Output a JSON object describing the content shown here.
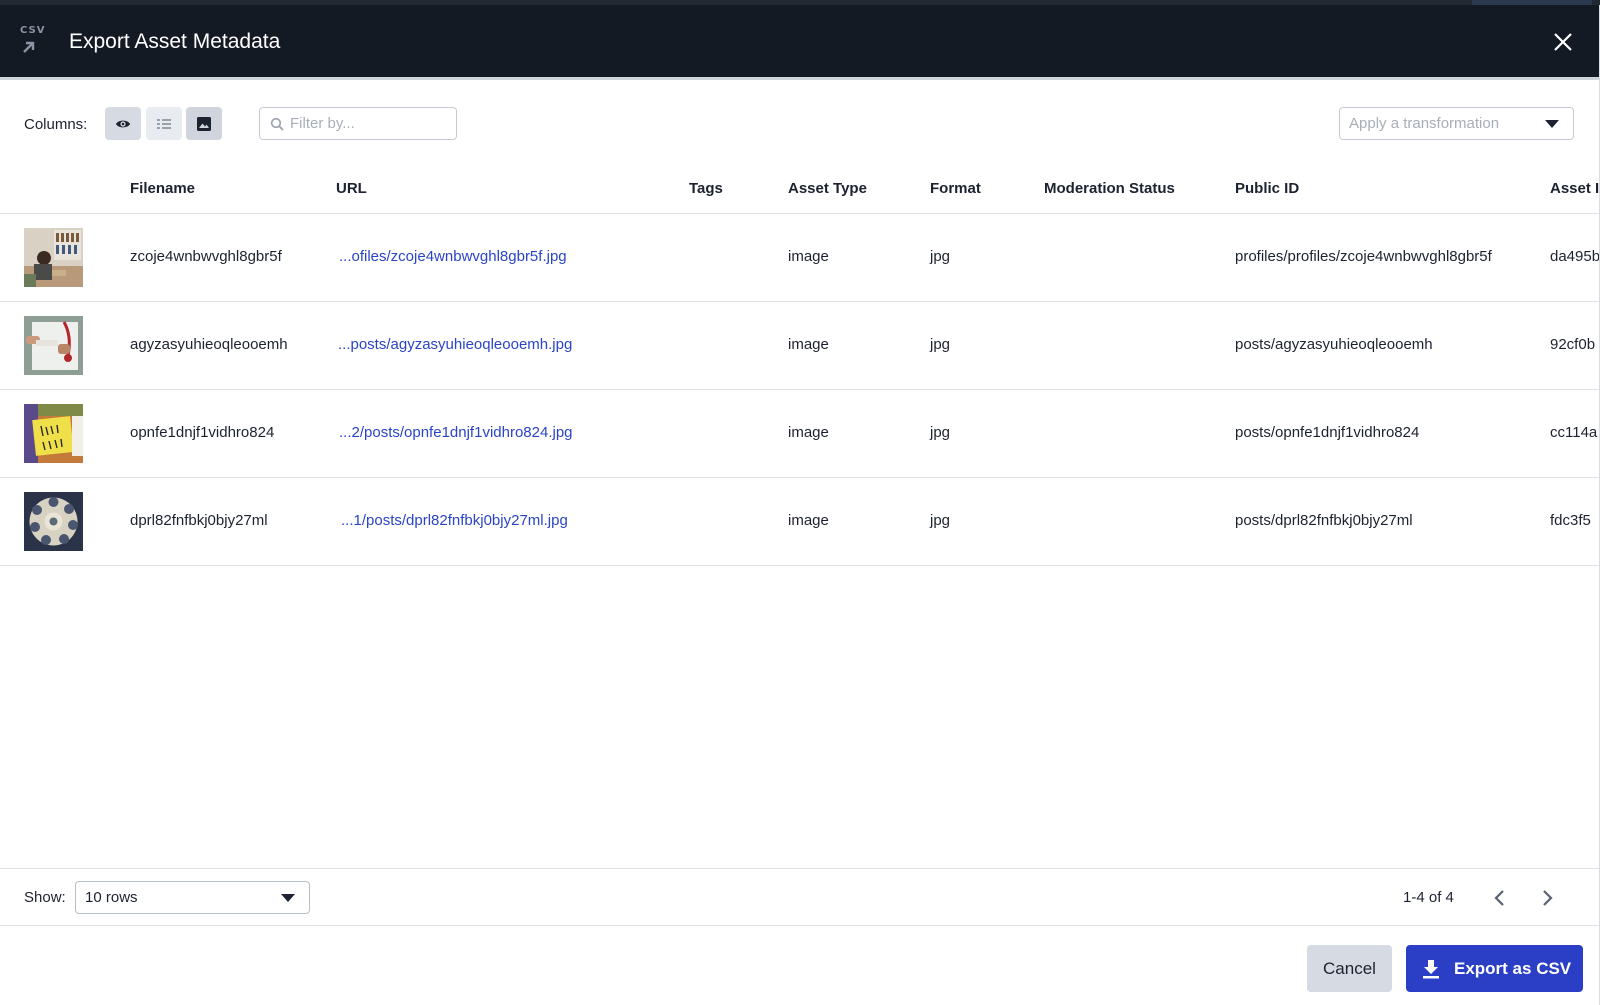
{
  "header": {
    "icon_text": "CSV",
    "title": "Export Asset Metadata"
  },
  "toolbar": {
    "columns_label": "Columns:",
    "filter_placeholder": "Filter by...",
    "transformation_placeholder": "Apply a transformation"
  },
  "table": {
    "columns": [
      "Filename",
      "URL",
      "Tags",
      "Asset Type",
      "Format",
      "Moderation Status",
      "Public ID",
      "Asset I"
    ],
    "rows": [
      {
        "filename": "zcoje4wnbwvghl8gbr5f",
        "url": "...ofiles/zcoje4wnbwvghl8gbr5f.jpg",
        "tags": "",
        "asset_type": "image",
        "format": "jpg",
        "moderation_status": "",
        "public_id": "profiles/profiles/zcoje4wnbwvghl8gbr5f",
        "asset_id": "da495b"
      },
      {
        "filename": "agyzasyuhieoqleooemh",
        "url": "...posts/agyzasyuhieoqleooemh.jpg",
        "tags": "",
        "asset_type": "image",
        "format": "jpg",
        "moderation_status": "",
        "public_id": "posts/agyzasyuhieoqleooemh",
        "asset_id": "92cf0b"
      },
      {
        "filename": "opnfe1dnjf1vidhro824",
        "url": "...2/posts/opnfe1dnjf1vidhro824.jpg",
        "tags": "",
        "asset_type": "image",
        "format": "jpg",
        "moderation_status": "",
        "public_id": "posts/opnfe1dnjf1vidhro824",
        "asset_id": "cc114a"
      },
      {
        "filename": "dprl82fnfbkj0bjy27ml",
        "url": "...1/posts/dprl82fnfbkj0bjy27ml.jpg",
        "tags": "",
        "asset_type": "image",
        "format": "jpg",
        "moderation_status": "",
        "public_id": "posts/dprl82fnfbkj0bjy27ml",
        "asset_id": "fdc3f5"
      }
    ]
  },
  "footer": {
    "show_label": "Show:",
    "rows_selected": "10 rows",
    "page_info": "1-4 of 4"
  },
  "actions": {
    "cancel_label": "Cancel",
    "export_label": "Export as CSV"
  },
  "colors": {
    "header_bg": "#141a24",
    "link": "#2b44c7",
    "primary_button": "#2a3fc5",
    "secondary_button": "#d6dae2"
  }
}
